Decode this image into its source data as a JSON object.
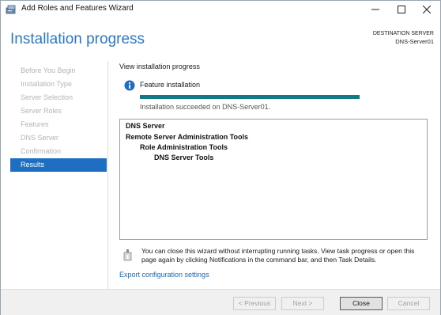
{
  "window": {
    "title": "Add Roles and Features Wizard"
  },
  "header": {
    "title": "Installation progress",
    "destination_label": "DESTINATION SERVER",
    "destination_server": "DNS-Server01"
  },
  "nav": {
    "items": [
      {
        "label": "Before You Begin",
        "state": "disabled"
      },
      {
        "label": "Installation Type",
        "state": "disabled"
      },
      {
        "label": "Server Selection",
        "state": "disabled"
      },
      {
        "label": "Server Roles",
        "state": "disabled"
      },
      {
        "label": "Features",
        "state": "disabled"
      },
      {
        "label": "DNS Server",
        "state": "disabled"
      },
      {
        "label": "Confirmation",
        "state": "disabled"
      },
      {
        "label": "Results",
        "state": "active"
      }
    ]
  },
  "main": {
    "heading": "View installation progress",
    "feature_label": "Feature installation",
    "progress_percent": 100,
    "success_message": "Installation succeeded on DNS-Server01.",
    "results": [
      {
        "text": "DNS Server",
        "level": 0
      },
      {
        "text": "Remote Server Administration Tools",
        "level": 0
      },
      {
        "text": "Role Administration Tools",
        "level": 1
      },
      {
        "text": "DNS Server Tools",
        "level": 2
      }
    ],
    "note": "You can close this wizard without interrupting running tasks. View task progress or open this page again by clicking Notifications in the command bar, and then Task Details.",
    "export_link": "Export configuration settings"
  },
  "footer": {
    "previous_label": "< Previous",
    "next_label": "Next >",
    "close_label": "Close",
    "cancel_label": "Cancel"
  },
  "colors": {
    "accent": "#1e6ec1",
    "title_blue": "#2c78c4",
    "progress": "#127a86",
    "link": "#1c67b8"
  }
}
